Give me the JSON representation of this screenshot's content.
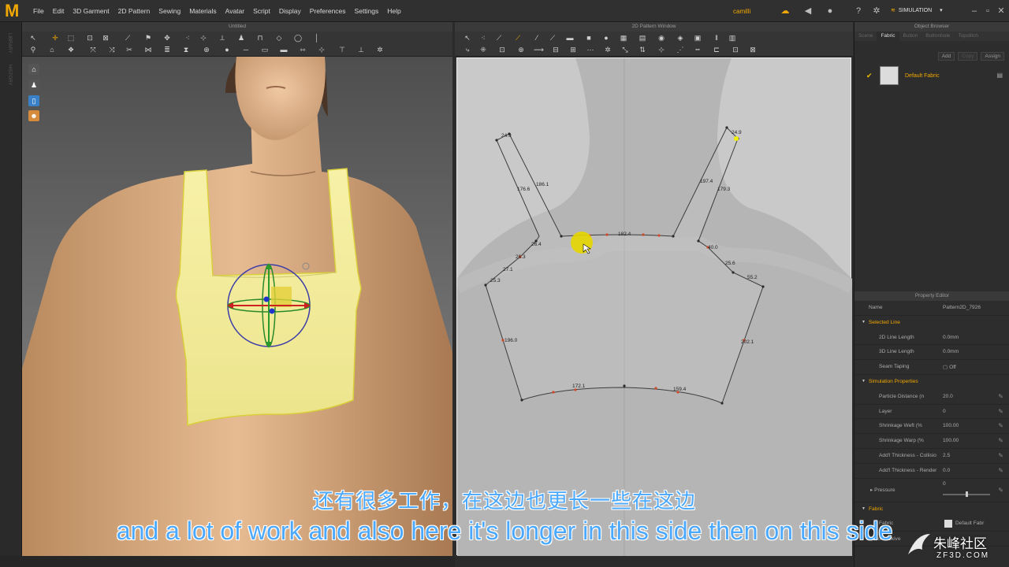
{
  "app": {
    "logo": "M"
  },
  "menu": [
    "File",
    "Edit",
    "3D Garment",
    "2D Pattern",
    "Sewing",
    "Materials",
    "Avatar",
    "Script",
    "Display",
    "Preferences",
    "Settings",
    "Help"
  ],
  "user": {
    "label": "camilli"
  },
  "mode": {
    "label": "SIMULATION"
  },
  "left_strip": [
    "LIBRARY",
    "HISTORY"
  ],
  "view3d": {
    "title": "Untitled"
  },
  "view2d": {
    "title": "2D Pattern Window",
    "measurements": [
      "24.9",
      "176.6",
      "186.1",
      "26.4",
      "26.3",
      "27.1",
      "25.3",
      "196.0",
      "182.4",
      "172.1",
      "159.4",
      "197.4",
      "179.3",
      "24.9",
      "40.0",
      "25.6",
      "55.2",
      "202.1"
    ]
  },
  "object_browser": {
    "title": "Object Browser",
    "tabs": [
      "Scene",
      "Fabric",
      "Button",
      "Buttonhole",
      "Topstitch"
    ],
    "active_tab": "Fabric",
    "buttons": {
      "add": "Add",
      "copy": "Copy",
      "assign": "Assign"
    },
    "fabric_item": "Default Fabric"
  },
  "property_editor": {
    "title": "Property Editor",
    "name_label": "Name",
    "name_value": "Pattern2D_7926",
    "section_selected_line": "Selected Line",
    "rows_selected_line": [
      {
        "k": "2D Line Length",
        "v": "0.0mm"
      },
      {
        "k": "3D Line Length",
        "v": "0.0mm"
      },
      {
        "k": "Seam Taping",
        "v": "Off"
      }
    ],
    "section_sim": "Simulation Properties",
    "rows_sim": [
      {
        "k": "Particle Distance (n",
        "v": "20.0"
      },
      {
        "k": "Layer",
        "v": "0"
      },
      {
        "k": "Shrinkage Weft (%",
        "v": "100.00"
      },
      {
        "k": "Shrinkage Warp (%",
        "v": "100.00"
      },
      {
        "k": "Add'l Thickness - Collisio",
        "v": "2.5"
      },
      {
        "k": "Add'l Thickness - Render",
        "v": "0.0"
      }
    ],
    "pressure_label": "Pressure",
    "pressure_value": "0",
    "section_fabric": "Fabric",
    "fabric_label": "Fabric",
    "fabric_value": "Default Fabr",
    "bond_label": "Bond/Skive"
  },
  "subtitles": {
    "chinese": "还有很多工作，在这边也更长一些在这边",
    "english": "and a lot of work and also here it's longer in this side then on this side"
  },
  "watermark": {
    "cn": "朱峰社区",
    "en": "ZF3D.COM"
  },
  "colors": {
    "accent": "#f0a800",
    "subtitle": "#4aa8ff",
    "garment": "#f5ee9a",
    "pattern_canvas": "#c9c9c9"
  }
}
